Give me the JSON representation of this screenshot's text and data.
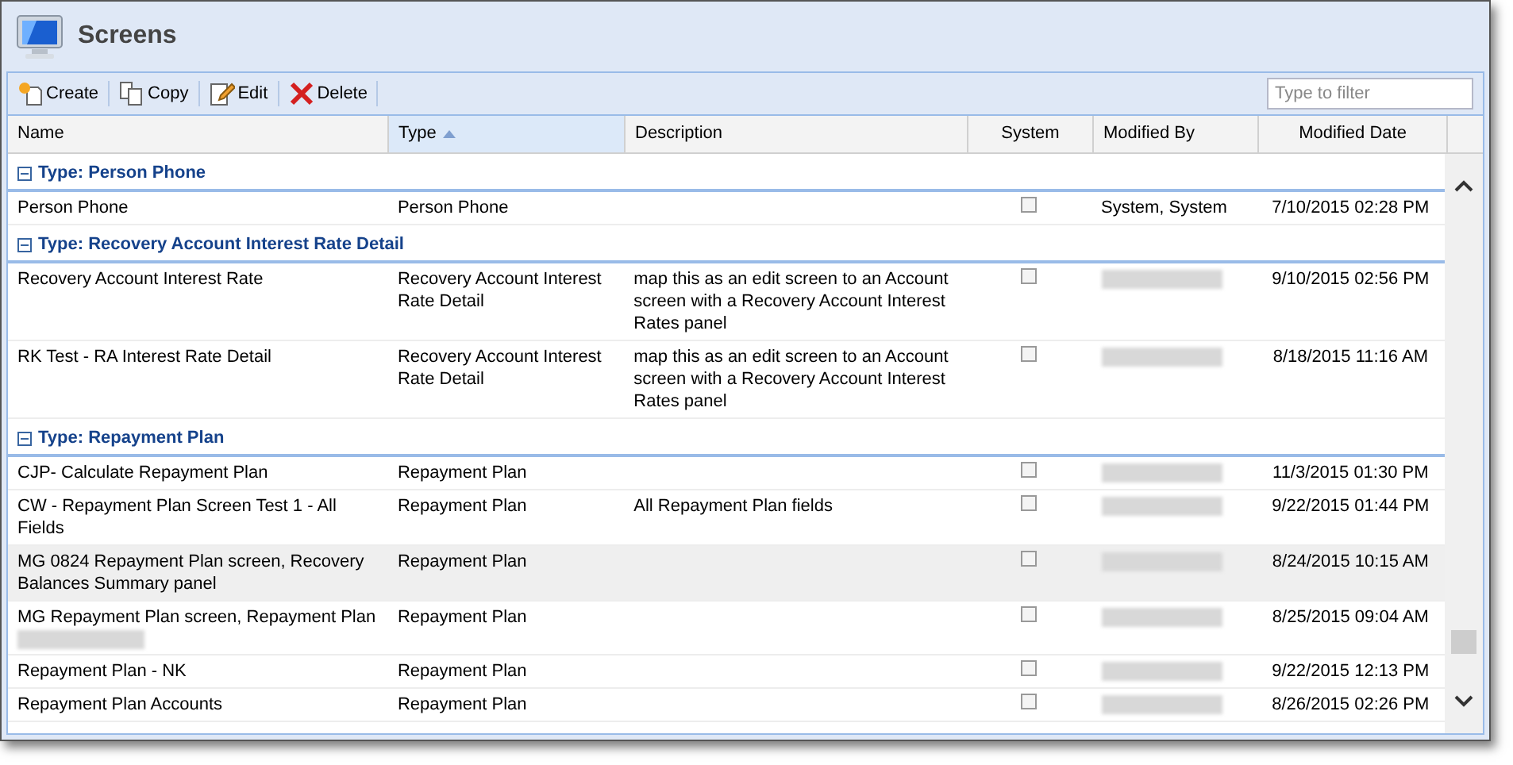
{
  "window": {
    "title": "Screens"
  },
  "toolbar": {
    "buttons": [
      {
        "label": "Create",
        "kind": "create"
      },
      {
        "label": "Copy",
        "kind": "copy"
      },
      {
        "label": "Edit",
        "kind": "edit"
      },
      {
        "label": "Delete",
        "kind": "delete"
      }
    ],
    "filter": {
      "placeholder": "Type to filter"
    }
  },
  "table": {
    "columns": [
      {
        "label": "Name",
        "sorted": false
      },
      {
        "label": "Type",
        "sorted": true
      },
      {
        "label": "Description",
        "sorted": false
      },
      {
        "label": "System",
        "sorted": false
      },
      {
        "label": "Modified By",
        "sorted": false
      },
      {
        "label": "Modified Date",
        "sorted": false
      }
    ],
    "groups": [
      {
        "label": "Type: Person Phone",
        "expanded": true,
        "rows": [
          {
            "name": "Person Phone",
            "type": "Person Phone",
            "description": "",
            "system": false,
            "modified_by": "System, System",
            "modified_date": "7/10/2015 02:28 PM",
            "selected": false
          }
        ]
      },
      {
        "label": "Type: Recovery Account Interest Rate Detail",
        "expanded": true,
        "rows": [
          {
            "name": "Recovery Account Interest Rate",
            "type": "Recovery Account Interest Rate Detail",
            "description": "map this as an edit screen to an Account screen with a Recovery Account Interest Rates panel",
            "system": false,
            "modified_by_redacted": true,
            "modified_date": "9/10/2015 02:56 PM",
            "selected": false
          },
          {
            "name": "RK Test - RA Interest Rate Detail",
            "type": "Recovery Account Interest Rate Detail",
            "description": "map this as an edit screen to an Account screen with a Recovery Account Interest Rates panel",
            "system": false,
            "modified_by_redacted": true,
            "modified_date": "8/18/2015 11:16 AM",
            "selected": false
          }
        ]
      },
      {
        "label": "Type: Repayment Plan",
        "expanded": true,
        "rows": [
          {
            "name": "CJP- Calculate Repayment Plan",
            "type": "Repayment Plan",
            "system": false,
            "modified_by_redacted": true,
            "modified_date": "11/3/2015 01:30 PM",
            "selected": false
          },
          {
            "name": "CW - Repayment Plan Screen Test 1 - All Fields",
            "type": "Repayment Plan",
            "description": "All Repayment Plan fields",
            "system": false,
            "modified_by_redacted": true,
            "modified_date": "9/22/2015 01:44 PM",
            "selected": false
          },
          {
            "name": "MG 0824 Repayment Plan screen, Recovery Balances Summary panel",
            "type": "Repayment Plan",
            "system": false,
            "modified_by_redacted": true,
            "modified_date": "8/24/2015 10:15 AM",
            "selected": true
          },
          {
            "name": "MG Repayment Plan screen, Repayment Plan",
            "name_redacted": true,
            "type": "Repayment Plan",
            "system": false,
            "modified_by_redacted": true,
            "modified_date": "8/25/2015 09:04 AM",
            "selected": false
          },
          {
            "name": "Repayment Plan - NK",
            "type": "Repayment Plan",
            "system": false,
            "modified_by_redacted": true,
            "modified_date": "9/22/2015 12:13 PM",
            "selected": false
          },
          {
            "name": "Repayment Plan Accounts",
            "type": "Repayment Plan",
            "system": false,
            "modified_by_redacted": true,
            "modified_date": "8/26/2015 02:26 PM",
            "selected": false
          }
        ]
      }
    ]
  }
}
